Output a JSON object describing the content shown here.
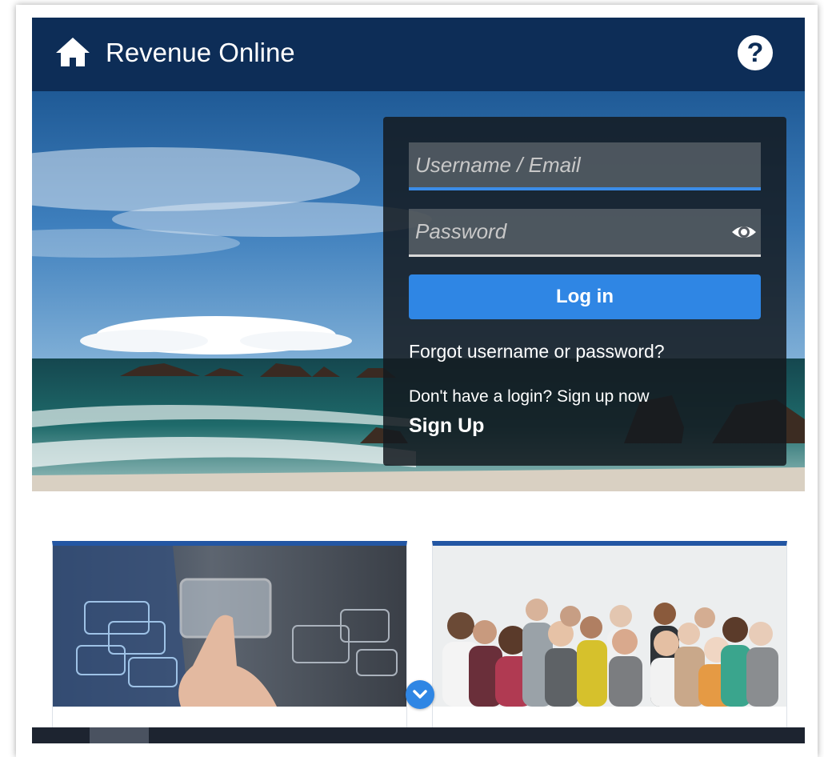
{
  "header": {
    "title": "Revenue Online",
    "home_icon": "home-icon",
    "help_label": "?"
  },
  "login": {
    "username_placeholder": "Username / Email",
    "password_placeholder": "Password",
    "show_password_icon": "eye-icon",
    "login_label": "Log in",
    "forgot_link": "Forgot username or password?",
    "signup_prompt": "Don't have a login? Sign up now",
    "signup_link": "Sign Up"
  },
  "cards": [
    {
      "image": "touchscreen-hand-image"
    },
    {
      "image": "group-of-people-image"
    }
  ],
  "scroll": {
    "icon": "chevron-down-icon"
  },
  "colors": {
    "header_bg": "#0d2d57",
    "accent": "#2f86e4",
    "card_border": "#2356a3",
    "panel_bg": "#141a20"
  }
}
